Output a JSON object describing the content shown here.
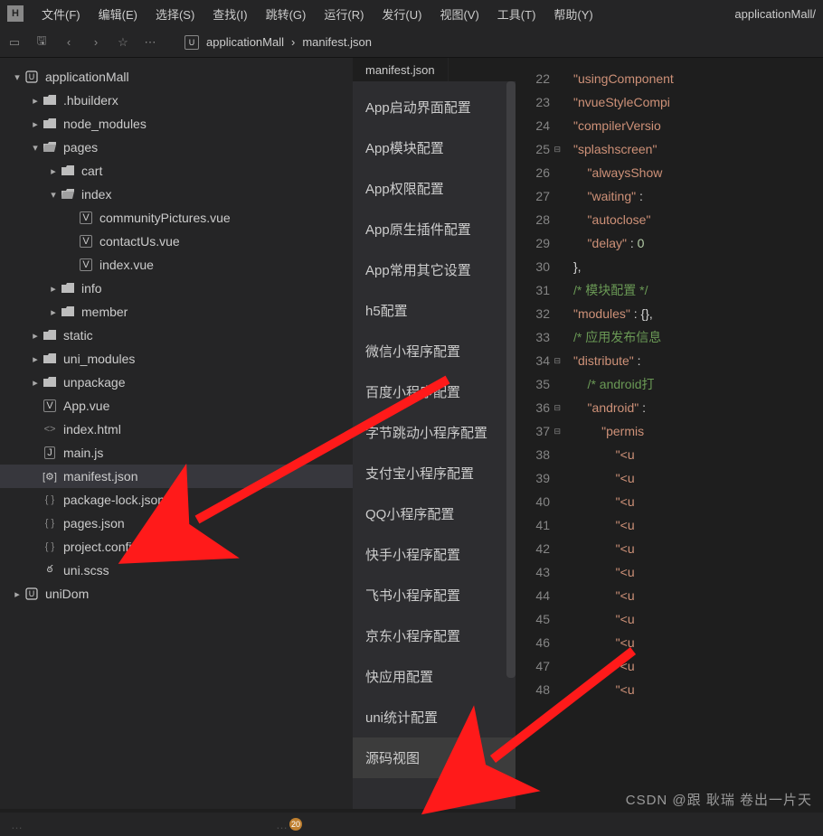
{
  "app": {
    "logo": "H",
    "title_right": "applicationMall/"
  },
  "menu": [
    {
      "label": "文件(F)"
    },
    {
      "label": "编辑(E)"
    },
    {
      "label": "选择(S)"
    },
    {
      "label": "查找(I)"
    },
    {
      "label": "跳转(G)"
    },
    {
      "label": "运行(R)"
    },
    {
      "label": "发行(U)"
    },
    {
      "label": "视图(V)"
    },
    {
      "label": "工具(T)"
    },
    {
      "label": "帮助(Y)"
    }
  ],
  "breadcrumb": {
    "icon_letter": "U",
    "part1": "applicationMall",
    "sep": "›",
    "part2": "manifest.json"
  },
  "tree": [
    {
      "indent": 0,
      "chev": "down",
      "icon": "proj",
      "label": "applicationMall"
    },
    {
      "indent": 1,
      "chev": "right",
      "icon": "folder",
      "label": ".hbuilderx"
    },
    {
      "indent": 1,
      "chev": "right",
      "icon": "folder",
      "label": "node_modules"
    },
    {
      "indent": 1,
      "chev": "down",
      "icon": "folder-open",
      "label": "pages"
    },
    {
      "indent": 2,
      "chev": "right",
      "icon": "folder",
      "label": "cart"
    },
    {
      "indent": 2,
      "chev": "down",
      "icon": "folder-open",
      "label": "index"
    },
    {
      "indent": 3,
      "chev": "",
      "icon": "vue",
      "label": "communityPictures.vue"
    },
    {
      "indent": 3,
      "chev": "",
      "icon": "vue",
      "label": "contactUs.vue"
    },
    {
      "indent": 3,
      "chev": "",
      "icon": "vue",
      "label": "index.vue"
    },
    {
      "indent": 2,
      "chev": "right",
      "icon": "folder",
      "label": "info"
    },
    {
      "indent": 2,
      "chev": "right",
      "icon": "folder",
      "label": "member"
    },
    {
      "indent": 1,
      "chev": "right",
      "icon": "folder",
      "label": "static"
    },
    {
      "indent": 1,
      "chev": "right",
      "icon": "folder",
      "label": "uni_modules"
    },
    {
      "indent": 1,
      "chev": "right",
      "icon": "folder",
      "label": "unpackage"
    },
    {
      "indent": 1,
      "chev": "",
      "icon": "vue",
      "label": "App.vue"
    },
    {
      "indent": 1,
      "chev": "",
      "icon": "html",
      "label": "index.html"
    },
    {
      "indent": 1,
      "chev": "",
      "icon": "js",
      "label": "main.js"
    },
    {
      "indent": 1,
      "chev": "",
      "icon": "config",
      "label": "manifest.json",
      "selected": true
    },
    {
      "indent": 1,
      "chev": "",
      "icon": "json",
      "label": "package-lock.json"
    },
    {
      "indent": 1,
      "chev": "",
      "icon": "json",
      "label": "pages.json"
    },
    {
      "indent": 1,
      "chev": "",
      "icon": "json",
      "label": "project.config.json"
    },
    {
      "indent": 1,
      "chev": "",
      "icon": "scss",
      "label": "uni.scss"
    },
    {
      "indent": 0,
      "chev": "right",
      "icon": "proj",
      "label": "uniDom"
    }
  ],
  "tab": {
    "label": "manifest.json"
  },
  "config_items": [
    "App启动界面配置",
    "App模块配置",
    "App权限配置",
    "App原生插件配置",
    "App常用其它设置",
    "h5配置",
    "微信小程序配置",
    "百度小程序配置",
    "字节跳动小程序配置",
    "支付宝小程序配置",
    "QQ小程序配置",
    "快手小程序配置",
    "飞书小程序配置",
    "京东小程序配置",
    "快应用配置",
    "uni统计配置",
    "源码视图"
  ],
  "config_selected_index": 16,
  "line_numbers": [
    22,
    23,
    24,
    25,
    26,
    27,
    28,
    29,
    30,
    31,
    32,
    33,
    34,
    35,
    36,
    37,
    38,
    39,
    40,
    41,
    42,
    43,
    44,
    45,
    46,
    47,
    48
  ],
  "fold_lines": [
    25,
    34,
    36,
    37
  ],
  "code_lines": [
    [
      {
        "t": "\"usingComponent",
        "c": "s-str"
      }
    ],
    [
      {
        "t": "\"nvueStyleCompi",
        "c": "s-str"
      }
    ],
    [
      {
        "t": "\"compilerVersio",
        "c": "s-str"
      }
    ],
    [
      {
        "t": "\"splashscreen\"",
        "c": "s-str"
      },
      {
        "t": " ",
        "c": "s-pun"
      }
    ],
    [
      {
        "t": "    \"alwaysShow",
        "c": "s-str"
      }
    ],
    [
      {
        "t": "    \"waiting\"",
        "c": "s-str"
      },
      {
        "t": " : ",
        "c": "s-pun"
      }
    ],
    [
      {
        "t": "    \"autoclose\"",
        "c": "s-str"
      }
    ],
    [
      {
        "t": "    \"delay\"",
        "c": "s-str"
      },
      {
        "t": " : ",
        "c": "s-pun"
      },
      {
        "t": "0",
        "c": "s-num"
      }
    ],
    [
      {
        "t": "},",
        "c": "s-pun"
      }
    ],
    [
      {
        "t": "/* 模块配置 */",
        "c": "s-cmt"
      }
    ],
    [
      {
        "t": "\"modules\"",
        "c": "s-str"
      },
      {
        "t": " : {},",
        "c": "s-pun"
      }
    ],
    [
      {
        "t": "/* 应用发布信息",
        "c": "s-cmt"
      }
    ],
    [
      {
        "t": "\"distribute\"",
        "c": "s-str"
      },
      {
        "t": " : ",
        "c": "s-pun"
      }
    ],
    [
      {
        "t": "    /* android打",
        "c": "s-cmt"
      }
    ],
    [
      {
        "t": "    \"android\"",
        "c": "s-str"
      },
      {
        "t": " : ",
        "c": "s-pun"
      }
    ],
    [
      {
        "t": "        \"permis",
        "c": "s-str"
      }
    ],
    [
      {
        "t": "            \"<u",
        "c": "s-str"
      }
    ],
    [
      {
        "t": "            \"<u",
        "c": "s-str"
      }
    ],
    [
      {
        "t": "            \"<u",
        "c": "s-str"
      }
    ],
    [
      {
        "t": "            \"<u",
        "c": "s-str"
      }
    ],
    [
      {
        "t": "            \"<u",
        "c": "s-str"
      }
    ],
    [
      {
        "t": "            \"<u",
        "c": "s-str"
      }
    ],
    [
      {
        "t": "            \"<u",
        "c": "s-str"
      }
    ],
    [
      {
        "t": "            \"<u",
        "c": "s-str"
      }
    ],
    [
      {
        "t": "            \"<u",
        "c": "s-str"
      }
    ],
    [
      {
        "t": "            \"<u",
        "c": "s-str"
      }
    ],
    [
      {
        "t": "            \"<u",
        "c": "s-str"
      }
    ]
  ],
  "watermark": "CSDN @跟 耿瑞 卷出一片天",
  "status": {
    "badge": "20"
  }
}
